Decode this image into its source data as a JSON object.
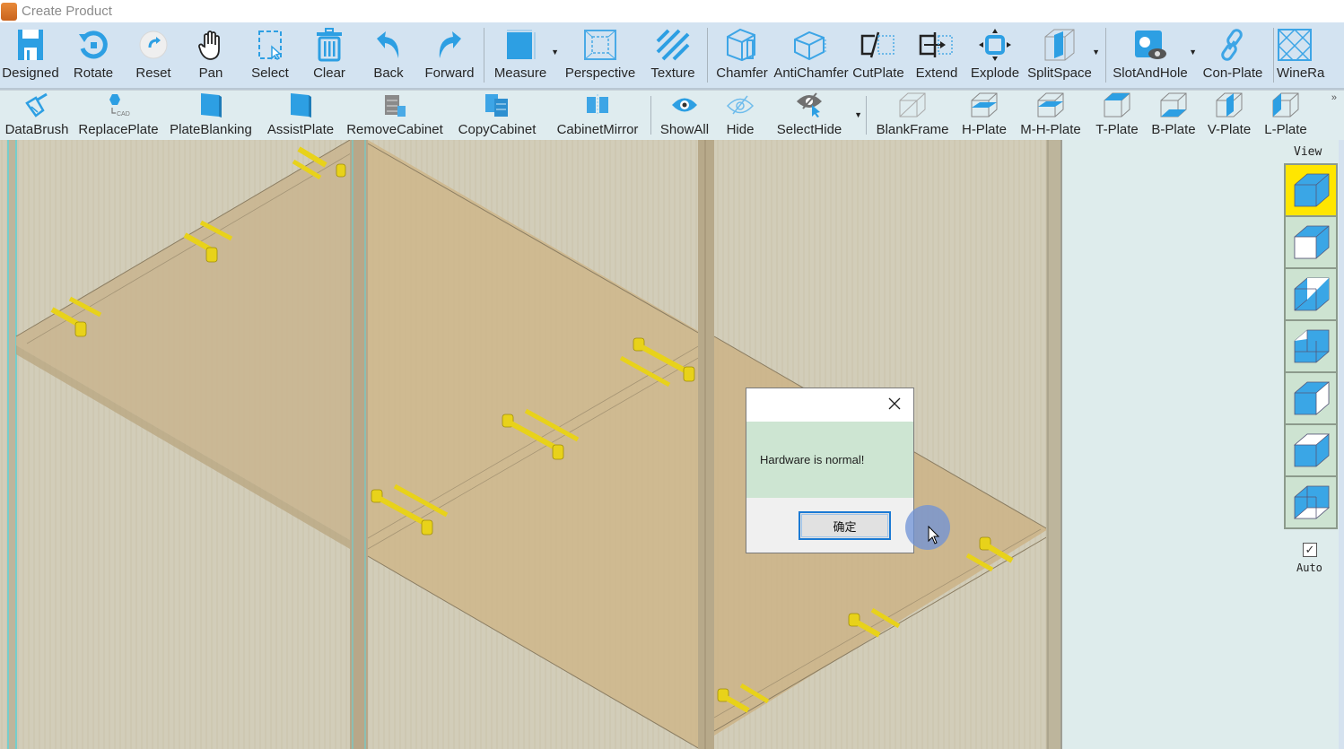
{
  "window": {
    "title": "Create Product",
    "app_icon": "app-icon"
  },
  "toolbar1": {
    "items": [
      {
        "label": "Designed",
        "icon": "save-icon"
      },
      {
        "label": "Rotate",
        "icon": "rotate-icon"
      },
      {
        "label": "Reset",
        "icon": "reset-icon"
      },
      {
        "label": "Pan",
        "icon": "hand-icon"
      },
      {
        "label": "Select",
        "icon": "select-icon"
      },
      {
        "label": "Clear",
        "icon": "trash-icon"
      },
      {
        "label": "Back",
        "icon": "undo-icon"
      },
      {
        "label": "Forward",
        "icon": "redo-icon"
      },
      {
        "label": "Measure",
        "icon": "measure-icon",
        "dropdown": true
      },
      {
        "label": "Perspective",
        "icon": "perspective-icon"
      },
      {
        "label": "Texture",
        "icon": "texture-icon"
      },
      {
        "label": "Chamfer",
        "icon": "chamfer-icon"
      },
      {
        "label": "AntiChamfer",
        "icon": "antichamfer-icon"
      },
      {
        "label": "CutPlate",
        "icon": "cutplate-icon"
      },
      {
        "label": "Extend",
        "icon": "extend-icon"
      },
      {
        "label": "Explode",
        "icon": "explode-icon"
      },
      {
        "label": "SplitSpace",
        "icon": "splitspace-icon",
        "dropdown": true
      },
      {
        "label": "SlotAndHole",
        "icon": "slot-hole-icon",
        "dropdown": true
      },
      {
        "label": "Con-Plate",
        "icon": "link-icon"
      },
      {
        "label": "WineRa",
        "icon": "winerack-icon"
      }
    ]
  },
  "toolbar2": {
    "items": [
      {
        "label": "DataBrush",
        "icon": "brush-icon"
      },
      {
        "label": "ReplacePlate",
        "icon": "replace-plate-icon",
        "sub": "CAD"
      },
      {
        "label": "PlateBlanking",
        "icon": "plate-icon"
      },
      {
        "label": "AssistPlate",
        "icon": "plate-icon"
      },
      {
        "label": "RemoveCabinet",
        "icon": "remove-cabinet-icon"
      },
      {
        "label": "CopyCabinet",
        "icon": "copy-cabinet-icon"
      },
      {
        "label": "CabinetMirror",
        "icon": "mirror-cabinet-icon"
      },
      {
        "label": "ShowAll",
        "icon": "eye-icon"
      },
      {
        "label": "Hide",
        "icon": "eye-off-icon"
      },
      {
        "label": "SelectHide",
        "icon": "select-hide-icon",
        "dropdown": true
      },
      {
        "label": "BlankFrame",
        "icon": "blank-frame-icon"
      },
      {
        "label": "H-Plate",
        "icon": "h-plate-icon"
      },
      {
        "label": "M-H-Plate",
        "icon": "m-h-plate-icon"
      },
      {
        "label": "T-Plate",
        "icon": "t-plate-icon"
      },
      {
        "label": "B-Plate",
        "icon": "b-plate-icon"
      },
      {
        "label": "V-Plate",
        "icon": "v-plate-icon"
      },
      {
        "label": "L-Plate",
        "icon": "l-plate-icon"
      }
    ],
    "overflow": "»"
  },
  "view_panel": {
    "title": "View",
    "views": [
      {
        "name": "view-iso",
        "active": true
      },
      {
        "name": "view-front",
        "active": false
      },
      {
        "name": "view-back",
        "active": false
      },
      {
        "name": "view-left",
        "active": false
      },
      {
        "name": "view-right",
        "active": false
      },
      {
        "name": "view-top",
        "active": false
      },
      {
        "name": "view-bottom",
        "active": false
      }
    ],
    "auto_checked": true,
    "auto_label": "Auto"
  },
  "dialog": {
    "message": "Hardware is normal!",
    "ok_label": "确定"
  },
  "colors": {
    "toolbar_bg": "#d3e3f1",
    "toolbar2_bg": "#dfecef",
    "icon_blue": "#2d9fe3",
    "hardware_yellow": "#e8d21a",
    "active_view": "#ffe600",
    "dialog_body": "#cde5d2"
  }
}
